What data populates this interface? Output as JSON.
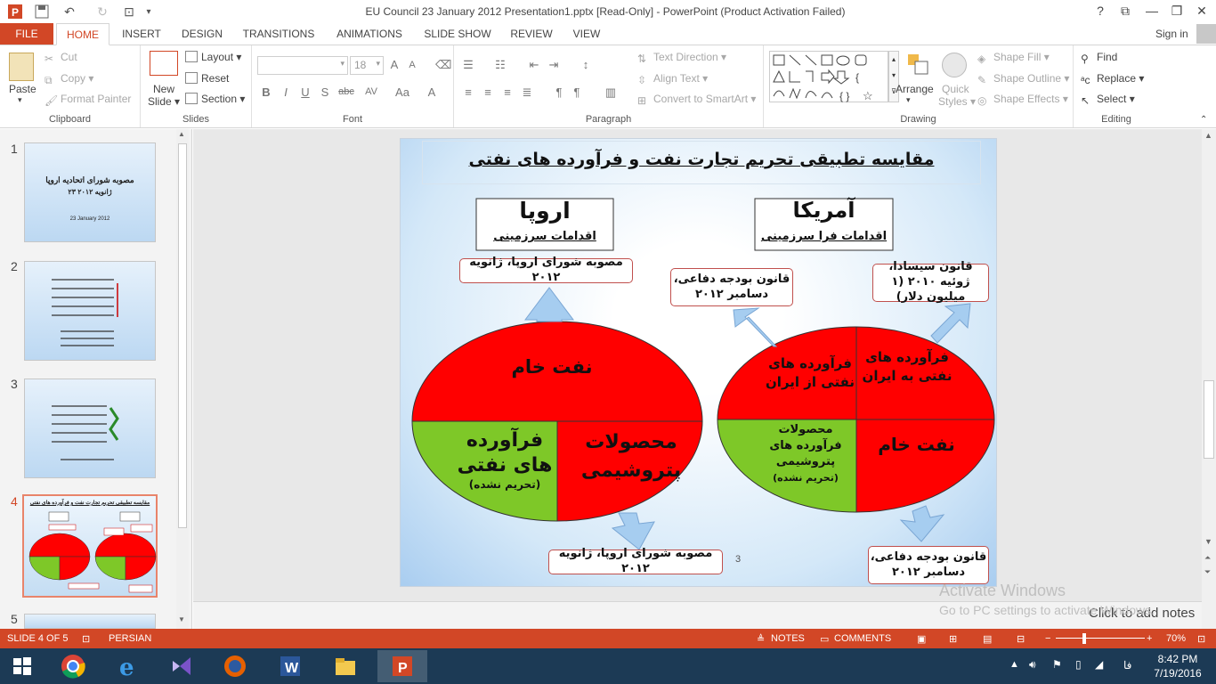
{
  "window": {
    "title": "EU Council 23 January 2012 Presentation1.pptx [Read-Only] - PowerPoint (Product Activation Failed)",
    "help": "?"
  },
  "tabs": {
    "file": "FILE",
    "items": [
      "HOME",
      "INSERT",
      "DESIGN",
      "TRANSITIONS",
      "ANIMATIONS",
      "SLIDE SHOW",
      "REVIEW",
      "VIEW"
    ],
    "active": "HOME",
    "sign_in": "Sign in"
  },
  "ribbon": {
    "clipboard": {
      "label": "Clipboard",
      "paste": "Paste",
      "cut": "Cut",
      "copy": "Copy",
      "format_painter": "Format Painter"
    },
    "slides": {
      "label": "Slides",
      "new_slide_1": "New",
      "new_slide_2": "Slide",
      "layout": "Layout",
      "reset": "Reset",
      "section": "Section"
    },
    "font": {
      "label": "Font",
      "font_size": "18",
      "bold": "B",
      "italic": "I",
      "underline": "U",
      "shadow": "S",
      "strike": "abc",
      "spacing": "AV",
      "case": "Aa",
      "color": "A"
    },
    "paragraph": {
      "label": "Paragraph",
      "text_direction": "Text Direction",
      "align_text": "Align Text",
      "convert_smartart": "Convert to SmartArt"
    },
    "drawing": {
      "label": "Drawing",
      "arrange": "Arrange",
      "quick_styles_1": "Quick",
      "quick_styles_2": "Styles",
      "shape_fill": "Shape Fill",
      "shape_outline": "Shape Outline",
      "shape_effects": "Shape Effects"
    },
    "editing": {
      "label": "Editing",
      "find": "Find",
      "replace": "Replace",
      "select": "Select"
    }
  },
  "thumbnails": [
    {
      "num": "1",
      "title": "مصوبه شورای اتحادیه اروپا",
      "subtitle": "۲۳ ژانویه ۲۰۱۲",
      "date": "23 January 2012"
    },
    {
      "num": "2"
    },
    {
      "num": "3"
    },
    {
      "num": "4",
      "selected": true,
      "title": "مقایسه تطبیقی تحریم تجارت نفت و فرآورده های نفتی"
    },
    {
      "num": "5"
    }
  ],
  "slide": {
    "title": "مقایسه تطبیقی تحریم تجارت نفت و فرآورده های نفتی",
    "europe_header": "اروپا",
    "europe_sub": "اقدامات سرزمینی",
    "us_header": "آمریکا",
    "us_sub": "اقدامات فرا سرزمینی",
    "eu_top_box": "مصوبه شورای اروپا، ژانویه ۲۰۱۲",
    "eu_bottom_box": "مصوبه شورای اروپا، ژانویه ۲۰۱۲",
    "us_box_left": "قانون بودجه دفاعی، دسامبر ۲۰۱۲",
    "us_box_right": "قانون سیسادا، ژوئیه ۲۰۱۰ (۱ میلیون دلار)",
    "us_box_bottom": "قانون بودجه دفاعی، دسامبر ۲۰۱۲",
    "eu_crude": "نفت خام",
    "eu_products_1": "فرآورده",
    "eu_products_2": "های نفتی",
    "eu_products_3": "(تحریم نشده)",
    "eu_petro_1": "محصولات",
    "eu_petro_2": "پتروشیمی",
    "us_q1": "فرآورده های نفتی از ایران",
    "us_q2": "فرآورده های نفتی به ایران",
    "us_q3_1": "محصولات فرآورده های پتروشیمی",
    "us_q3_2": "(تحریم نشده)",
    "us_q4": "نفت خام",
    "page_number": "3"
  },
  "notes": {
    "placeholder": "Click to add notes"
  },
  "watermark": {
    "line1": "Activate Windows",
    "line2": "Go to PC settings to activate Windows."
  },
  "status": {
    "slide_info": "SLIDE 4 OF 5",
    "language": "PERSIAN",
    "notes": "NOTES",
    "comments": "COMMENTS",
    "zoom": "70%"
  },
  "taskbar": {
    "time": "8:42 PM",
    "date": "7/19/2016",
    "lang": "فا"
  },
  "colors": {
    "accent": "#d24726",
    "taskbar": "#1c3a55",
    "red": "#ff0000",
    "green": "#7ec828"
  }
}
